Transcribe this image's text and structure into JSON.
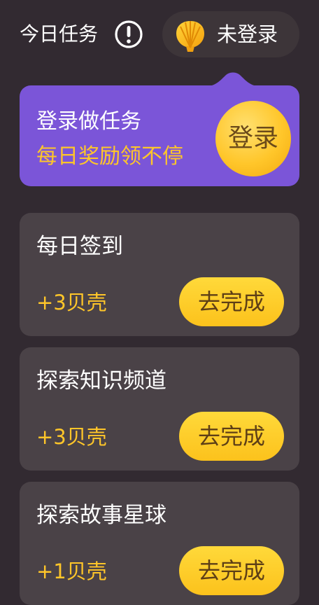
{
  "header": {
    "title": "今日任务",
    "info_icon": "exclamation-circle-icon",
    "login_status": "未登录",
    "shell_icon": "shell-icon"
  },
  "promo": {
    "title": "登录做任务",
    "subtitle": "每日奖励领不停",
    "button_label": "登录"
  },
  "tasks": [
    {
      "name": "每日签到",
      "reward": "+3贝壳",
      "button_label": "去完成"
    },
    {
      "name": "探索知识频道",
      "reward": "+3贝壳",
      "button_label": "去完成"
    },
    {
      "name": "探索故事星球",
      "reward": "+1贝壳",
      "button_label": "去完成"
    }
  ],
  "colors": {
    "background": "#322a31",
    "card": "#4a4247",
    "promo": "#7b55d8",
    "accent_yellow": "#ffc629"
  }
}
